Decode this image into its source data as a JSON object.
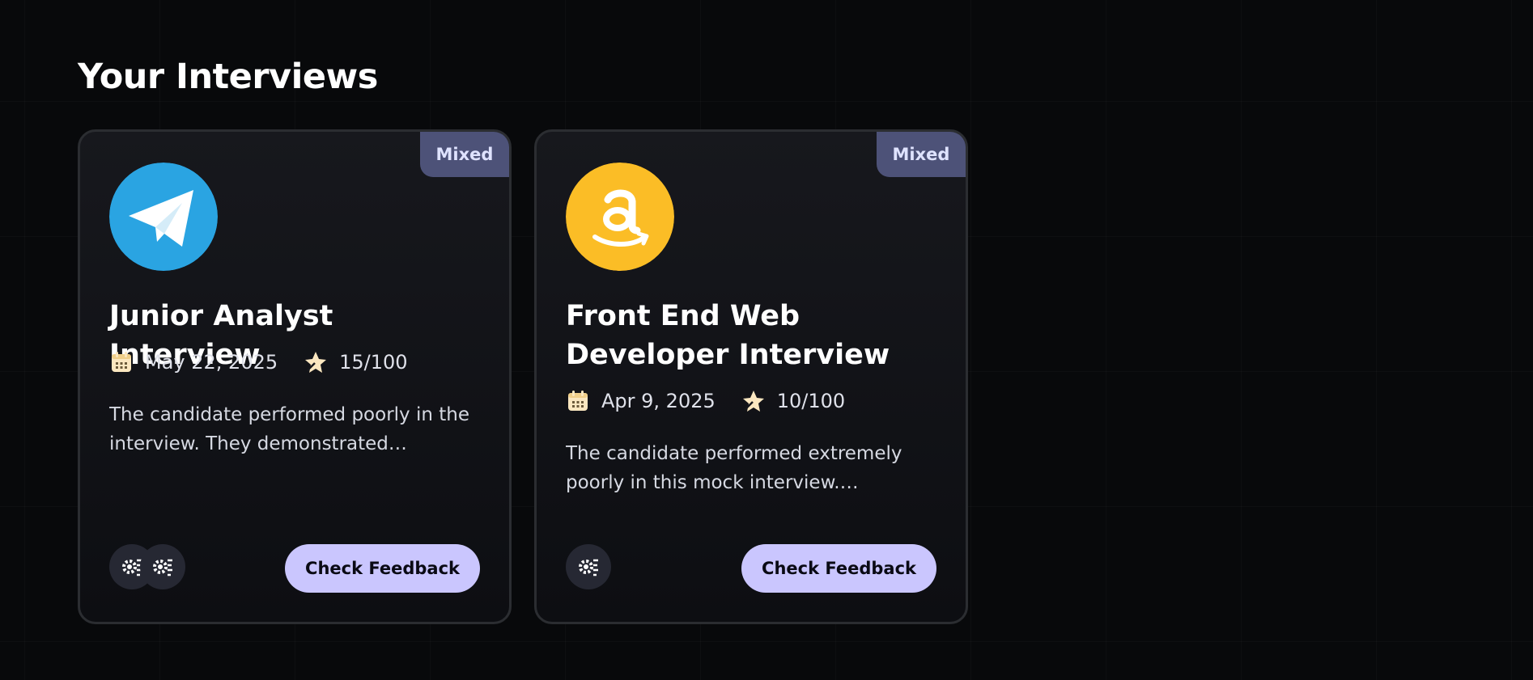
{
  "page": {
    "title": "Your Interviews"
  },
  "interviews": [
    {
      "type_badge": "Mixed",
      "company_logo_icon": "telegram-logo-icon",
      "role": "Junior Analyst Interview",
      "date": "May 22, 2025",
      "score": "15/100",
      "description": "The candidate performed poorly in the interview. They demonstrated significant...",
      "tech_icons": [
        "tech-stack-icon",
        "tech-stack-icon"
      ],
      "action_label": "Check Feedback"
    },
    {
      "type_badge": "Mixed",
      "company_logo_icon": "amazon-logo-icon",
      "role": "Front End Web Developer Interview",
      "date": "Apr 9, 2025",
      "score": "10/100",
      "description": "The candidate performed extremely poorly in this mock interview. Significant...",
      "tech_icons": [
        "tech-stack-icon"
      ],
      "action_label": "Check Feedback"
    }
  ],
  "colors": {
    "background": "#08090b",
    "card_background": "#15161b",
    "badge_background": "#4d5278",
    "button_background": "#cac6fe",
    "telegram_blue": "#2aa4e2",
    "amazon_yellow": "#fbbd26",
    "icon_cream": "#fbe7c0"
  }
}
